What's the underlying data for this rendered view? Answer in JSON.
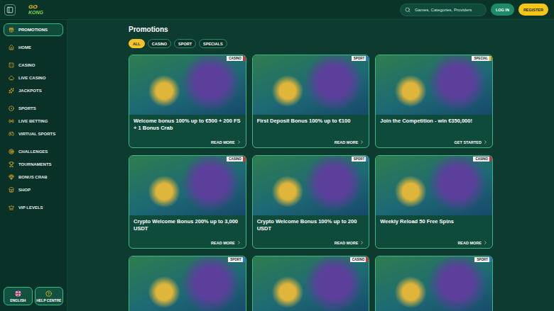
{
  "header": {
    "logo": {
      "top": "GO",
      "bottom": "KONG"
    },
    "search": {
      "placeholder": "Games, Categories, Providers"
    },
    "buttons": [
      {
        "label": "LOG IN",
        "kind": "secondary"
      },
      {
        "label": "REGISTER",
        "kind": "primary"
      }
    ]
  },
  "sidebar": {
    "groups": [
      [
        {
          "label": "PROMOTIONS",
          "selected": true
        }
      ],
      [
        {
          "label": "HOME",
          "selected": false
        }
      ],
      [
        {
          "label": "CASINO",
          "selected": false
        },
        {
          "label": "LIVE CASINO",
          "selected": false
        },
        {
          "label": "JACKPOTS",
          "selected": false
        }
      ],
      [
        {
          "label": "SPORTS",
          "selected": false
        },
        {
          "label": "LIVE BETTING",
          "selected": false
        },
        {
          "label": "VIRTUAL SPORTS",
          "selected": false
        }
      ],
      [
        {
          "label": "CHALLENGES",
          "selected": false
        },
        {
          "label": "TOURNAMENTS",
          "selected": false
        },
        {
          "label": "BONUS CRAB",
          "selected": false
        },
        {
          "label": "SHOP",
          "selected": false
        }
      ],
      [
        {
          "label": "VIP LEVELS",
          "selected": false
        }
      ]
    ],
    "footer": [
      {
        "label": "ENGLISH",
        "kind": "language"
      },
      {
        "label": "HELP CENTRE",
        "kind": "help"
      }
    ]
  },
  "page": {
    "title": "Promotions",
    "filters": [
      {
        "label": "ALL",
        "selected": true
      },
      {
        "label": "CASINO",
        "selected": false
      },
      {
        "label": "SPORT",
        "selected": false
      },
      {
        "label": "SPECIALS",
        "selected": false
      }
    ]
  },
  "cards": [
    {
      "tag": "CASINO",
      "color": "#d8312f",
      "title": "Welcome bonus 100% up to €500 + 200 FS + 1 Bonus Crab",
      "action": "READ MORE"
    },
    {
      "tag": "SPORT",
      "color": "#2a78d8",
      "title": "First Deposit Bonus 100% up to €100",
      "action": "READ MORE"
    },
    {
      "tag": "SPECIAL",
      "color": "#e6b422",
      "title": "Join the Competition - win €350,000!",
      "action": "GET STARTED"
    },
    {
      "tag": "CASINO",
      "color": "#d8312f",
      "title": "Crypto Welcome Bonus 200% up to 3,000 USDT",
      "action": "READ MORE"
    },
    {
      "tag": "SPORT",
      "color": "#2a78d8",
      "title": "Crypto Welcome Bonus 100% up to 200 USDT",
      "action": "READ MORE"
    },
    {
      "tag": "CASINO",
      "color": "#d8312f",
      "title": "Weekly Reload 50 Free Spins",
      "action": "READ MORE"
    },
    {
      "tag": "SPORT",
      "color": "#2a78d8"
    },
    {
      "tag": "CASINO",
      "color": "#d8312f"
    },
    {
      "tag": "SPORT",
      "color": "#2a78d8"
    }
  ]
}
